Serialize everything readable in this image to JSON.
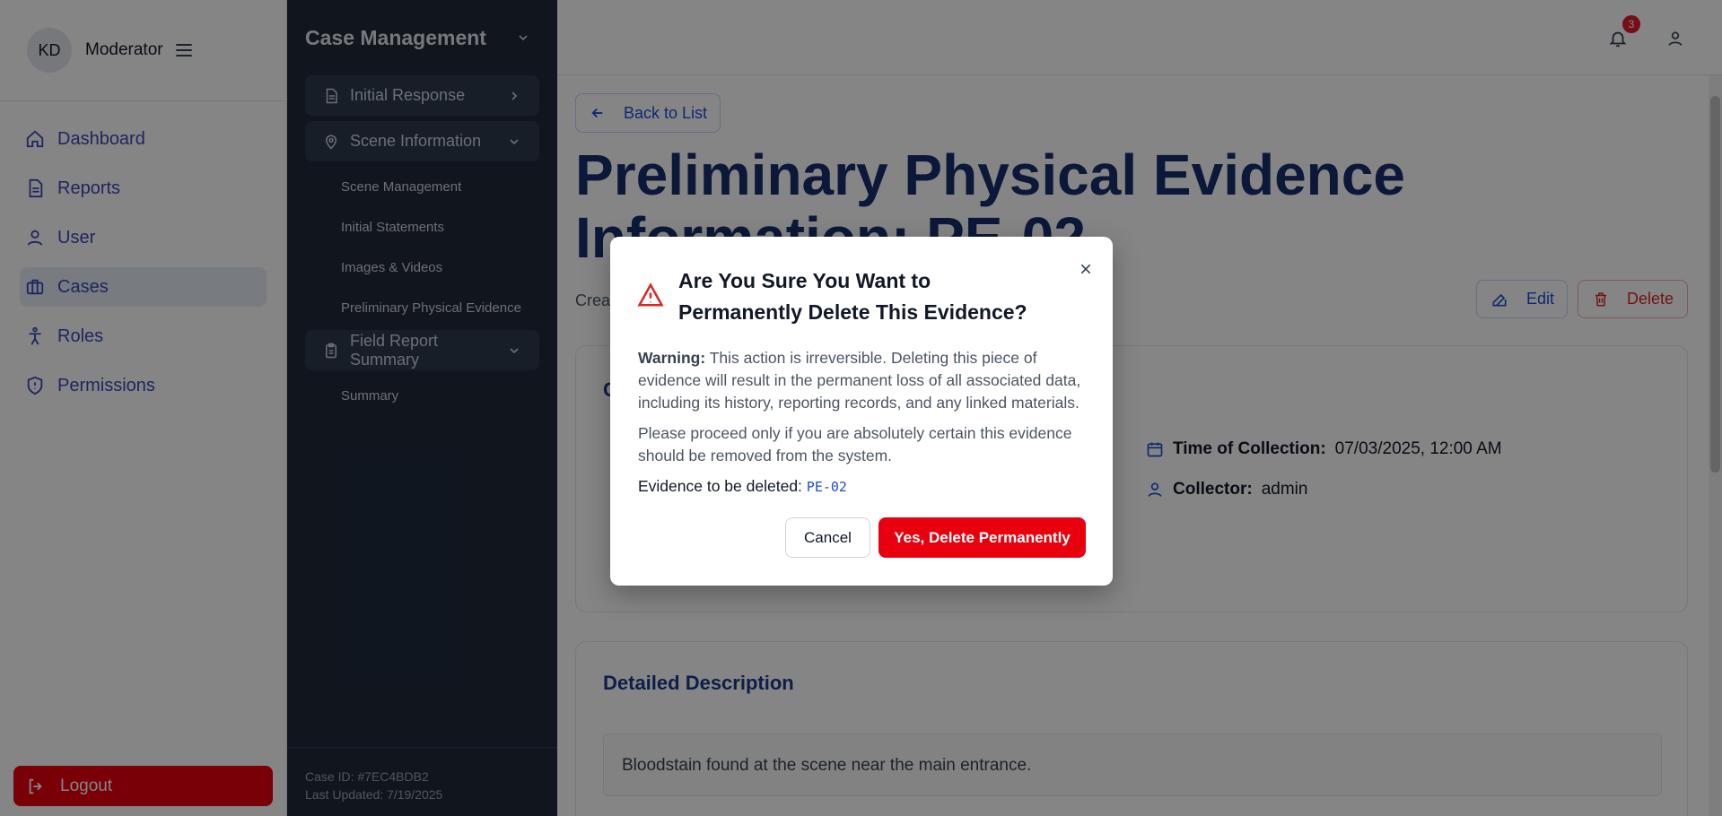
{
  "sidebar": {
    "avatar_initials": "KD",
    "role": "Moderator",
    "items": [
      {
        "label": "Dashboard",
        "icon": "home-icon"
      },
      {
        "label": "Reports",
        "icon": "document-icon"
      },
      {
        "label": "User",
        "icon": "user-icon"
      },
      {
        "label": "Cases",
        "icon": "briefcase-icon"
      },
      {
        "label": "Roles",
        "icon": "person-icon"
      },
      {
        "label": "Permissions",
        "icon": "shield-icon"
      }
    ],
    "active_item": "Cases",
    "logout_label": "Logout"
  },
  "case_panel": {
    "title": "Case Management",
    "sections": [
      {
        "label": "Initial Response",
        "subitems": []
      },
      {
        "label": "Scene Information",
        "subitems": [
          "Scene Management",
          "Initial Statements",
          "Images & Videos",
          "Preliminary Physical Evidence"
        ]
      },
      {
        "label": "Field Report Summary",
        "subitems": [
          "Summary"
        ]
      }
    ],
    "footer": {
      "case_id": "Case ID: #7EC4BDB2",
      "last_updated": "Last Updated: 7/19/2025"
    }
  },
  "topbar": {
    "notification_count": "3"
  },
  "main": {
    "back_label": "Back to List",
    "title": "Preliminary Physical Evidence Information: PE-02",
    "created_partial": "Crea",
    "edit_label": "Edit",
    "delete_label": "Delete",
    "card1_heading_partial": "C",
    "fields": {
      "time_label": "Time of Collection:",
      "time_value": "07/03/2025, 12:00 AM",
      "collector_label": "Collector:",
      "collector_value": "admin"
    },
    "description_title": "Detailed Description",
    "description": "Bloodstain found at the scene near the main entrance."
  },
  "modal": {
    "title": "Are You Sure You Want to Permanently Delete This Evidence?",
    "warning_label": "Warning:",
    "warning_text": " This action is irreversible. Deleting this piece of evidence will result in the permanent loss of all associated data, including its history, reporting records, and any linked materials.",
    "proceed_text": "Please proceed only if you are absolutely certain this evidence should be removed from the system.",
    "evidence_label": "Evidence to be deleted:",
    "evidence_id": "PE-02",
    "cancel_label": "Cancel",
    "confirm_label": "Yes, Delete Permanently"
  },
  "colors": {
    "primary_blue": "#3a49b6",
    "title_navy": "#172f6e",
    "danger_red": "#e8000f",
    "panel_dark": "#1f2a3b"
  }
}
